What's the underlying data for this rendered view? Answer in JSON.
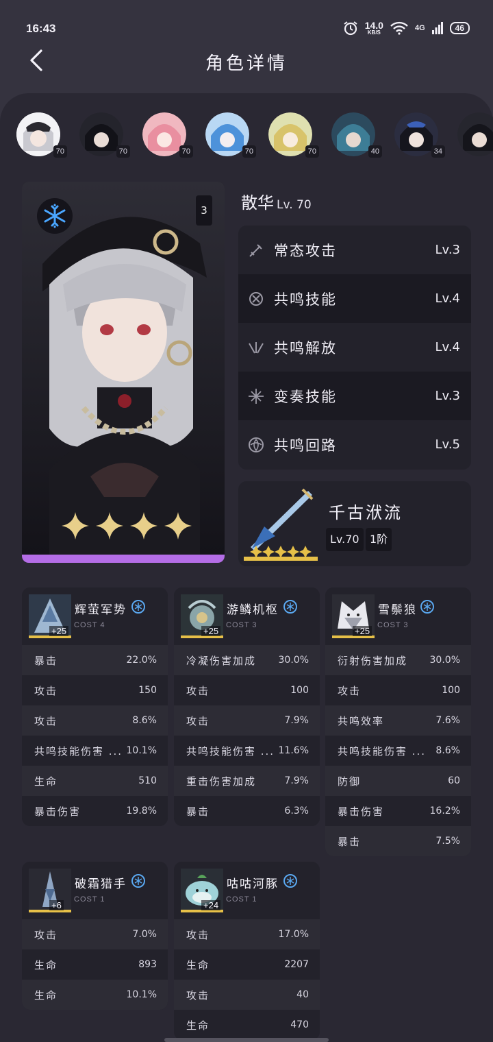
{
  "status": {
    "time": "16:43",
    "net_speed": "14.0",
    "net_unit": "KB/S",
    "network": "4G",
    "battery": "46"
  },
  "header": {
    "title": "角色详情"
  },
  "avatars": [
    {
      "level": "70"
    },
    {
      "level": "70"
    },
    {
      "level": "70"
    },
    {
      "level": "70"
    },
    {
      "level": "70"
    },
    {
      "level": "40"
    },
    {
      "level": "34"
    },
    {
      "level": ""
    }
  ],
  "character": {
    "name": "散华",
    "level": "Lv. 70",
    "rank": "3",
    "stars": 4,
    "element": "glacio-snowflake-icon"
  },
  "skills": [
    {
      "label": "常态攻击",
      "level": "Lv.3",
      "icon": "sword-icon"
    },
    {
      "label": "共鸣技能",
      "level": "Lv.4",
      "icon": "resonance-skill-icon"
    },
    {
      "label": "共鸣解放",
      "level": "Lv.4",
      "icon": "liberation-icon"
    },
    {
      "label": "变奏技能",
      "level": "Lv.3",
      "icon": "intro-skill-icon"
    },
    {
      "label": "共鸣回路",
      "level": "Lv.5",
      "icon": "circuit-icon"
    }
  ],
  "weapon": {
    "name": "千古洑流",
    "level": "Lv.70",
    "rank": "1阶",
    "stars": 5
  },
  "echoes": [
    {
      "name": "辉萤军势",
      "cost": "COST 4",
      "level": "+25",
      "stats": [
        {
          "name": "暴击",
          "value": "22.0%"
        },
        {
          "name": "攻击",
          "value": "150"
        },
        {
          "name": "攻击",
          "value": "8.6%"
        },
        {
          "name": "共鸣技能伤害 ...",
          "value": "10.1%"
        },
        {
          "name": "生命",
          "value": "510"
        },
        {
          "name": "暴击伤害",
          "value": "19.8%"
        }
      ]
    },
    {
      "name": "游鳞机枢",
      "cost": "COST 3",
      "level": "+25",
      "stats": [
        {
          "name": "冷凝伤害加成",
          "value": "30.0%"
        },
        {
          "name": "攻击",
          "value": "100"
        },
        {
          "name": "攻击",
          "value": "7.9%"
        },
        {
          "name": "共鸣技能伤害 ...",
          "value": "11.6%"
        },
        {
          "name": "重击伤害加成",
          "value": "7.9%"
        },
        {
          "name": "暴击",
          "value": "6.3%"
        }
      ]
    },
    {
      "name": "雪鬃狼",
      "cost": "COST 3",
      "level": "+25",
      "stats": [
        {
          "name": "衍射伤害加成",
          "value": "30.0%"
        },
        {
          "name": "攻击",
          "value": "100"
        },
        {
          "name": "共鸣效率",
          "value": "7.6%"
        },
        {
          "name": "共鸣技能伤害 ...",
          "value": "8.6%"
        },
        {
          "name": "防御",
          "value": "60"
        },
        {
          "name": "暴击伤害",
          "value": "16.2%"
        },
        {
          "name": "暴击",
          "value": "7.5%"
        }
      ]
    },
    {
      "name": "破霜猎手",
      "cost": "COST 1",
      "level": "+6",
      "stats": [
        {
          "name": "攻击",
          "value": "7.0%"
        },
        {
          "name": "生命",
          "value": "893"
        },
        {
          "name": "生命",
          "value": "10.1%"
        }
      ]
    },
    {
      "name": "咕咕河豚",
      "cost": "COST 1",
      "level": "+24",
      "stats": [
        {
          "name": "攻击",
          "value": "17.0%"
        },
        {
          "name": "生命",
          "value": "2207"
        },
        {
          "name": "攻击",
          "value": "40"
        },
        {
          "name": "生命",
          "value": "470"
        }
      ]
    }
  ],
  "colors": {
    "background": "#35333f",
    "panel": "#2a2833",
    "accent_purple": "#b46de6",
    "gold": "#e6c048",
    "glacio_blue": "#5aa8f0"
  }
}
